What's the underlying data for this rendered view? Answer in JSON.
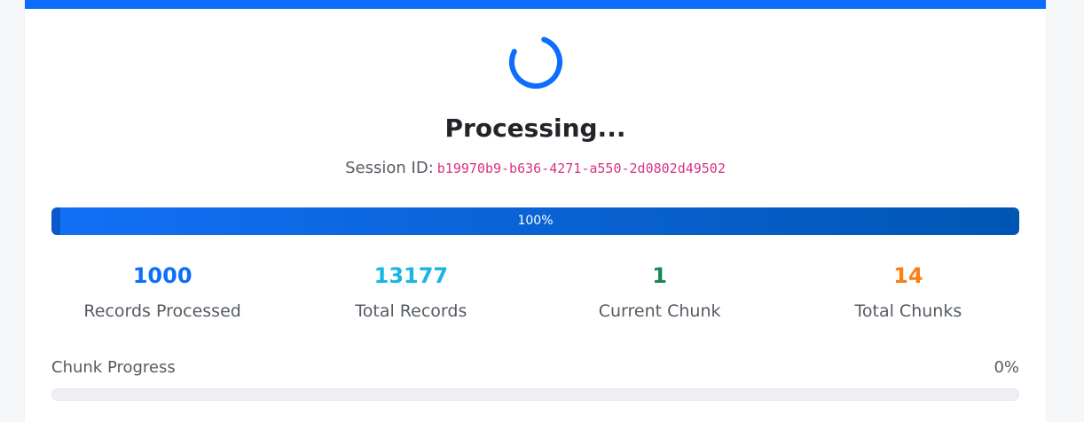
{
  "status": {
    "title": "Processing...",
    "session_label": "Session ID:",
    "session_id": "b19970b9-b636-4271-a550-2d0802d49502"
  },
  "overall_progress": {
    "percent": 100,
    "label": "100%"
  },
  "stats": [
    {
      "value": "1000",
      "label": "Records Processed",
      "color": "#0d6efd"
    },
    {
      "value": "13177",
      "label": "Total Records",
      "color": "#17b6e6"
    },
    {
      "value": "1",
      "label": "Current Chunk",
      "color": "#198754"
    },
    {
      "value": "14",
      "label": "Total Chunks",
      "color": "#fd7e14"
    }
  ],
  "chunk_progress": {
    "label": "Chunk Progress",
    "percent": 0,
    "percent_label": "0%"
  },
  "colors": {
    "accent": "#0d6efd",
    "session_id": "#d63384"
  }
}
